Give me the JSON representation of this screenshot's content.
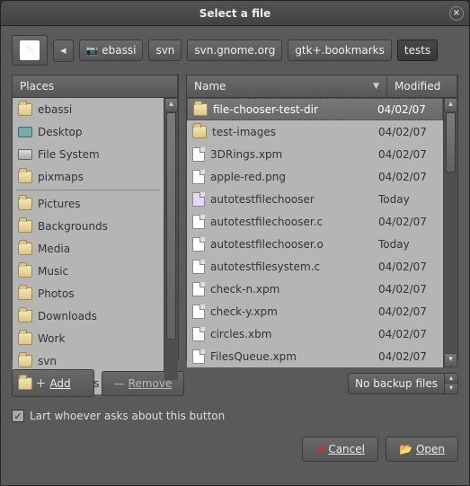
{
  "window": {
    "title": "Select a file"
  },
  "pathbar": {
    "segments": [
      "ebassi",
      "svn",
      "svn.gnome.org",
      "gtk+.bookmarks",
      "tests"
    ],
    "active_index": 4
  },
  "places": {
    "header": "Places",
    "top": [
      {
        "label": "ebassi",
        "icon": "folder"
      },
      {
        "label": "Desktop",
        "icon": "desktop"
      },
      {
        "label": "File System",
        "icon": "drive"
      },
      {
        "label": "pixmaps",
        "icon": "folder"
      }
    ],
    "bookmarks": [
      {
        "label": "Pictures",
        "icon": "folder"
      },
      {
        "label": "Backgrounds",
        "icon": "folder"
      },
      {
        "label": "Media",
        "icon": "folder"
      },
      {
        "label": "Music",
        "icon": "folder"
      },
      {
        "label": "Photos",
        "icon": "folder"
      },
      {
        "label": "Downloads",
        "icon": "folder"
      },
      {
        "label": "Work",
        "icon": "folder"
      },
      {
        "label": "svn",
        "icon": "folder"
      },
      {
        "label": "Documents",
        "icon": "folder"
      }
    ]
  },
  "files": {
    "columns": {
      "name": "Name",
      "modified": "Modified"
    },
    "rows": [
      {
        "name": "file-chooser-test-dir",
        "modified": "04/02/07",
        "icon": "folder",
        "selected": true
      },
      {
        "name": "test-images",
        "modified": "04/02/07",
        "icon": "folder"
      },
      {
        "name": "3DRings.xpm",
        "modified": "04/02/07",
        "icon": "file"
      },
      {
        "name": "apple-red.png",
        "modified": "04/02/07",
        "icon": "file"
      },
      {
        "name": "autotestfilechooser",
        "modified": "Today",
        "icon": "exec"
      },
      {
        "name": "autotestfilechooser.c",
        "modified": "04/02/07",
        "icon": "file"
      },
      {
        "name": "autotestfilechooser.o",
        "modified": "Today",
        "icon": "file"
      },
      {
        "name": "autotestfilesystem.c",
        "modified": "04/02/07",
        "icon": "file"
      },
      {
        "name": "check-n.xpm",
        "modified": "04/02/07",
        "icon": "file"
      },
      {
        "name": "check-y.xpm",
        "modified": "04/02/07",
        "icon": "file"
      },
      {
        "name": "circles.xbm",
        "modified": "04/02/07",
        "icon": "file"
      },
      {
        "name": "FilesQueue.xpm",
        "modified": "04/02/07",
        "icon": "file"
      }
    ]
  },
  "buttons": {
    "add": "Add",
    "remove": "Remove",
    "filter": "No backup files",
    "cancel": "Cancel",
    "open": "Open"
  },
  "checkbox": {
    "checked": true,
    "label": "Lart whoever asks about this button"
  }
}
